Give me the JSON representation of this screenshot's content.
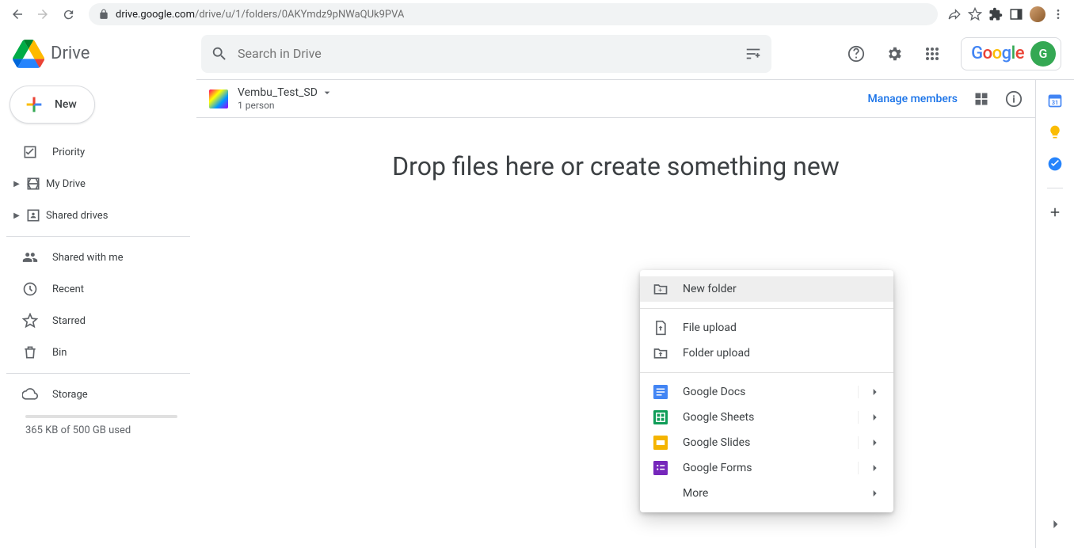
{
  "url": {
    "domain": "drive.google.com",
    "path": "/drive/u/1/folders/0AKYmdz9pNWaQUk9PVA"
  },
  "app": {
    "name": "Drive"
  },
  "search": {
    "placeholder": "Search in Drive"
  },
  "account": {
    "logo": "Google",
    "initial": "G"
  },
  "newButton": {
    "label": "New"
  },
  "sidebar": {
    "items": [
      {
        "label": "Priority"
      },
      {
        "label": "My Drive"
      },
      {
        "label": "Shared drives"
      },
      {
        "label": "Shared with me"
      },
      {
        "label": "Recent"
      },
      {
        "label": "Starred"
      },
      {
        "label": "Bin"
      },
      {
        "label": "Storage"
      }
    ],
    "storageText": "365 KB of 500 GB used"
  },
  "breadcrumb": {
    "title": "Vembu_Test_SD",
    "subtitle": "1 person",
    "manage": "Manage members"
  },
  "emptyMessage": "Drop files here or create something new",
  "contextMenu": {
    "items": [
      {
        "label": "New folder"
      },
      {
        "label": "File upload"
      },
      {
        "label": "Folder upload"
      },
      {
        "label": "Google Docs"
      },
      {
        "label": "Google Sheets"
      },
      {
        "label": "Google Slides"
      },
      {
        "label": "Google Forms"
      },
      {
        "label": "More"
      }
    ]
  }
}
